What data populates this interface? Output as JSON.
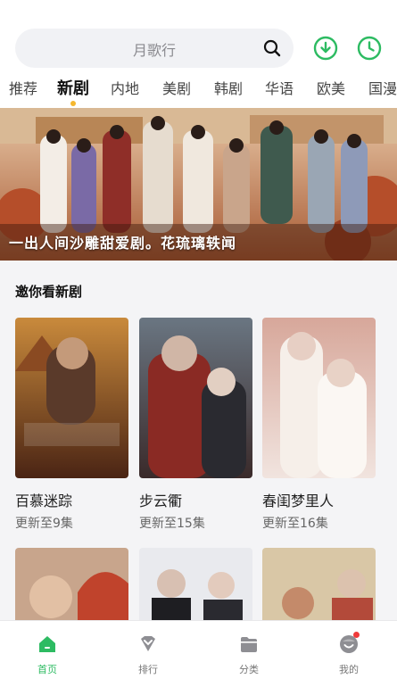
{
  "search": {
    "placeholder": "月歌行"
  },
  "header_actions": [
    {
      "icon": "download-icon"
    },
    {
      "icon": "history-clock-icon"
    }
  ],
  "tabs": [
    {
      "label": "推荐"
    },
    {
      "label": "新剧",
      "active": true
    },
    {
      "label": "内地"
    },
    {
      "label": "美剧"
    },
    {
      "label": "韩剧"
    },
    {
      "label": "华语"
    },
    {
      "label": "欧美"
    },
    {
      "label": "国漫"
    }
  ],
  "banner": {
    "caption": "一出人间沙雕甜爱剧。花琉璃轶闻"
  },
  "section": {
    "title": "邀你看新剧",
    "cards": [
      {
        "title": "百慕迷踪",
        "subtitle": "更新至9集"
      },
      {
        "title": "步云衢",
        "subtitle": "更新至15集"
      },
      {
        "title": "春闺梦里人",
        "subtitle": "更新至16集"
      }
    ]
  },
  "bottom_nav": [
    {
      "label": "首页",
      "icon": "home-icon",
      "active": true
    },
    {
      "label": "排行",
      "icon": "ranking-icon"
    },
    {
      "label": "分类",
      "icon": "category-folder-icon"
    },
    {
      "label": "我的",
      "icon": "profile-icon",
      "has_badge": true
    }
  ],
  "colors": {
    "accent": "#2dbb62",
    "tab_indicator": "#f5b72e",
    "badge": "#f03b3b"
  }
}
